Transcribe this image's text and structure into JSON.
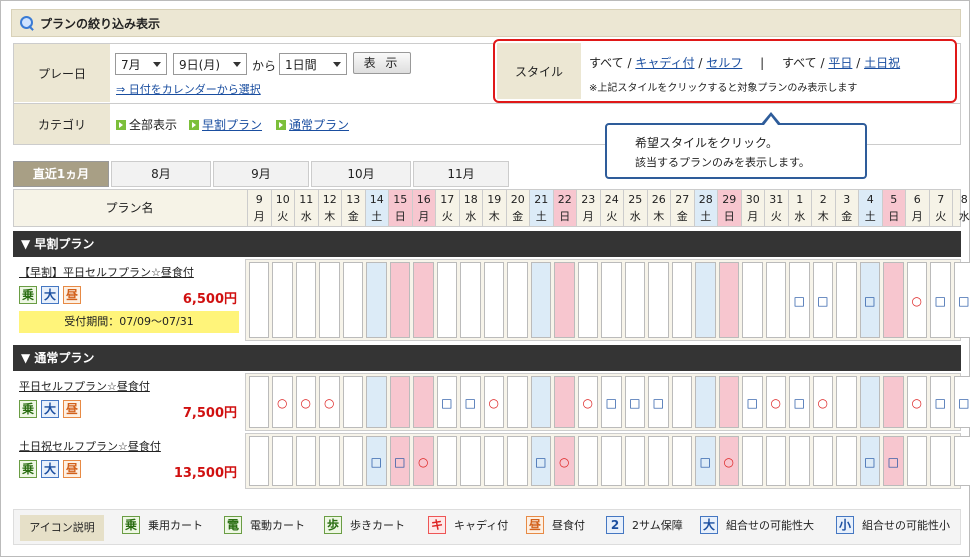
{
  "header": {
    "title": "プランの絞り込み表示",
    "icon": "search-icon"
  },
  "filter": {
    "play_label": "プレー日",
    "month_value": "7月",
    "day_value": "9日(月)",
    "kara": "から",
    "span_value": "1日間",
    "show_button": "表 示",
    "calendar_link": "⇒ 日付をカレンダーから選択",
    "category_label": "カテゴリ",
    "categories": [
      "全部表示",
      "早割プラン",
      "通常プラン"
    ],
    "style_label": "スタイル",
    "style_all1": "すべて",
    "style_caddy": "キャディ付",
    "style_self": "セルフ",
    "sep": "/",
    "pipe": "|",
    "style_all2": "すべて",
    "style_weekday": "平日",
    "style_holiday": "土日祝",
    "style_note": "※上記スタイルをクリックすると対象プランのみ表示します"
  },
  "tooltip": {
    "title": "希望スタイルをクリック。",
    "body": "該当するプランのみを表示します。"
  },
  "tabs": [
    "直近1ヵ月",
    "8月",
    "9月",
    "10月",
    "11月"
  ],
  "plan_header": "プラン名",
  "days": [
    {
      "d": "9",
      "w": "月",
      "t": "n"
    },
    {
      "d": "10",
      "w": "火",
      "t": "n"
    },
    {
      "d": "11",
      "w": "水",
      "t": "n"
    },
    {
      "d": "12",
      "w": "木",
      "t": "n"
    },
    {
      "d": "13",
      "w": "金",
      "t": "n"
    },
    {
      "d": "14",
      "w": "土",
      "t": "s"
    },
    {
      "d": "15",
      "w": "日",
      "t": "h"
    },
    {
      "d": "16",
      "w": "月",
      "t": "h"
    },
    {
      "d": "17",
      "w": "火",
      "t": "n"
    },
    {
      "d": "18",
      "w": "水",
      "t": "n"
    },
    {
      "d": "19",
      "w": "木",
      "t": "n"
    },
    {
      "d": "20",
      "w": "金",
      "t": "n"
    },
    {
      "d": "21",
      "w": "土",
      "t": "s"
    },
    {
      "d": "22",
      "w": "日",
      "t": "h"
    },
    {
      "d": "23",
      "w": "月",
      "t": "n"
    },
    {
      "d": "24",
      "w": "火",
      "t": "n"
    },
    {
      "d": "25",
      "w": "水",
      "t": "n"
    },
    {
      "d": "26",
      "w": "木",
      "t": "n"
    },
    {
      "d": "27",
      "w": "金",
      "t": "n"
    },
    {
      "d": "28",
      "w": "土",
      "t": "s"
    },
    {
      "d": "29",
      "w": "日",
      "t": "h"
    },
    {
      "d": "30",
      "w": "月",
      "t": "n"
    },
    {
      "d": "31",
      "w": "火",
      "t": "n"
    },
    {
      "d": "1",
      "w": "水",
      "t": "n"
    },
    {
      "d": "2",
      "w": "木",
      "t": "n"
    },
    {
      "d": "3",
      "w": "金",
      "t": "n"
    },
    {
      "d": "4",
      "w": "土",
      "t": "s"
    },
    {
      "d": "5",
      "w": "日",
      "t": "h"
    },
    {
      "d": "6",
      "w": "月",
      "t": "n"
    },
    {
      "d": "7",
      "w": "火",
      "t": "n"
    },
    {
      "d": "8",
      "w": "水",
      "t": "n"
    }
  ],
  "sections": [
    {
      "title": "▼ 早割プラン",
      "plans": [
        {
          "name": "【早割】平日セルフプラン☆昼食付",
          "price": "6,500円",
          "period": "受付期間：07/09〜07/31",
          "icons": [
            {
              "c": "乗",
              "k": "g"
            },
            {
              "c": "大",
              "k": "b"
            },
            {
              "c": "昼",
              "k": "o"
            }
          ],
          "marks": [
            "",
            "",
            "",
            "",
            "",
            "",
            "",
            "",
            "",
            "",
            "",
            "",
            "",
            "",
            "",
            "",
            "",
            "",
            "",
            "",
            "",
            "",
            "",
            "□",
            "□",
            "",
            "□",
            "",
            "○",
            "□",
            "□"
          ]
        }
      ]
    },
    {
      "title": "▼ 通常プラン",
      "plans": [
        {
          "name": "平日セルフプラン☆昼食付",
          "price": "7,500円",
          "icons": [
            {
              "c": "乗",
              "k": "g"
            },
            {
              "c": "大",
              "k": "b"
            },
            {
              "c": "昼",
              "k": "o"
            }
          ],
          "marks": [
            "",
            "○",
            "○",
            "○",
            "",
            "",
            "",
            "",
            "□",
            "□",
            "○",
            "",
            "",
            "",
            "○",
            "□",
            "□",
            "□",
            "",
            "",
            "",
            "□",
            "○",
            "□",
            "○",
            "",
            "",
            "",
            "○",
            "□",
            "□"
          ]
        },
        {
          "name": "土日祝セルフプラン☆昼食付",
          "price": "13,500円",
          "icons": [
            {
              "c": "乗",
              "k": "g"
            },
            {
              "c": "大",
              "k": "b"
            },
            {
              "c": "昼",
              "k": "o"
            }
          ],
          "marks": [
            "",
            "",
            "",
            "",
            "",
            "□",
            "□",
            "○",
            "",
            "",
            "",
            "",
            "□",
            "○",
            "",
            "",
            "",
            "",
            "",
            "□",
            "○",
            "",
            "",
            "",
            "",
            "",
            "□",
            "□",
            "",
            "",
            ""
          ]
        }
      ]
    }
  ],
  "legend": {
    "label": "アイコン説明",
    "items": [
      {
        "c": "乗",
        "k": "g",
        "t": "乗用カート"
      },
      {
        "c": "電",
        "k": "g",
        "t": "電動カート"
      },
      {
        "c": "歩",
        "k": "g",
        "t": "歩きカート"
      },
      {
        "c": "キ",
        "k": "r",
        "t": "キャディ付"
      },
      {
        "c": "昼",
        "k": "o",
        "t": "昼食付"
      },
      {
        "c": "2",
        "k": "b",
        "t": "2サム保障"
      },
      {
        "c": "大",
        "k": "b",
        "t": "組合せの可能性大"
      },
      {
        "c": "小",
        "k": "b",
        "t": "組合せの可能性小"
      }
    ]
  },
  "colors": {
    "sat": "#dcebf7",
    "hol": "#f7c6cf",
    "mark_circle": "#d22",
    "mark_square": "#1a4ea0",
    "accent_red": "#d01010"
  }
}
